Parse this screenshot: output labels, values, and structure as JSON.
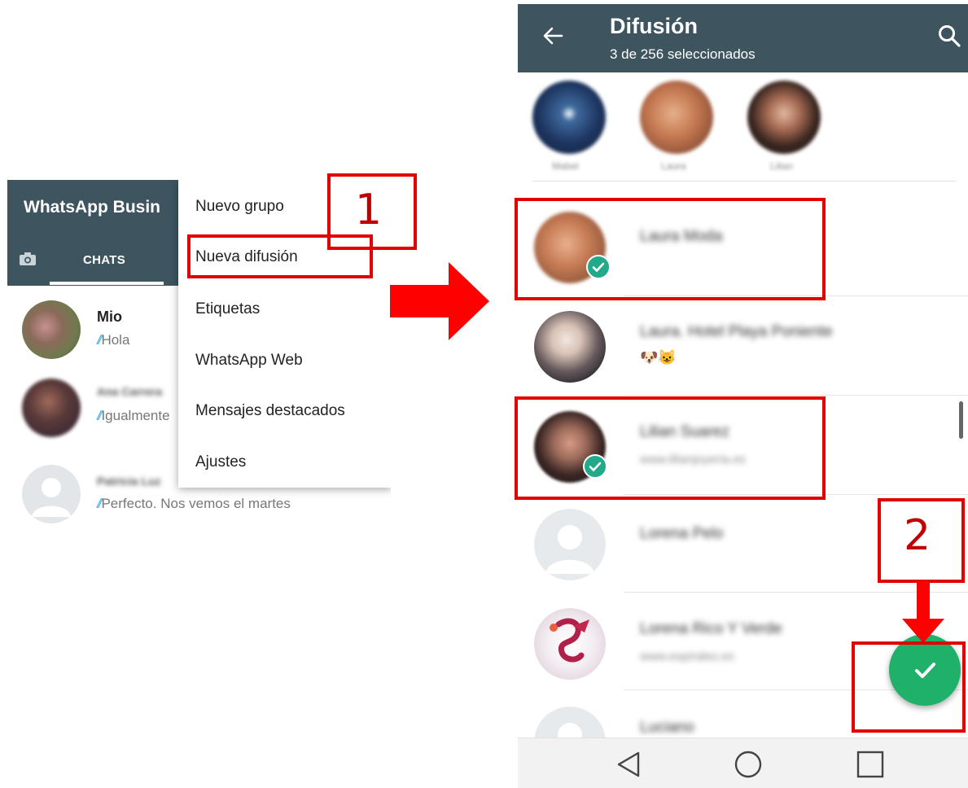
{
  "left_panel": {
    "app_title": "WhatsApp Busin",
    "tab_chats": "CHATS",
    "chats": [
      {
        "name": "Mio",
        "ticks": "//",
        "message": "Hola"
      },
      {
        "name": "Ana Carrera",
        "ticks": "//",
        "message": "Igualmente"
      },
      {
        "name": "Patricia Luz",
        "ticks": "//",
        "message": "Perfecto. Nos vemos el martes"
      }
    ],
    "menu": [
      "Nuevo grupo",
      "Nueva difusión",
      "Etiquetas",
      "WhatsApp Web",
      "Mensajes destacados",
      "Ajustes"
    ]
  },
  "annotations": {
    "step1": "1",
    "step2": "2",
    "color": "#e00000"
  },
  "right_panel": {
    "title": "Difusión",
    "subtitle": "3 de 256 seleccionados",
    "selected": [
      {
        "label": "Mabel"
      },
      {
        "label": "Laura"
      },
      {
        "label": "Lilian"
      }
    ],
    "contacts": [
      {
        "name": "Laura Moda",
        "status": "",
        "selected": true
      },
      {
        "name": "Laura. Hotel Playa Poniente",
        "status": "🐶😺",
        "selected": false
      },
      {
        "name": "Lilian Suarez",
        "status": "www.lilianjoyeria.es",
        "selected": true
      },
      {
        "name": "Lorena Pelo",
        "status": "",
        "selected": false
      },
      {
        "name": "Lorena Rico Y Verde",
        "status": "www.espirales.es",
        "selected": false
      },
      {
        "name": "Luciano",
        "status": "",
        "selected": false
      }
    ]
  },
  "colors": {
    "header": "#3e5560",
    "check": "#22a98a",
    "fab": "#1fb16a",
    "tick": "#4fb3e8"
  }
}
